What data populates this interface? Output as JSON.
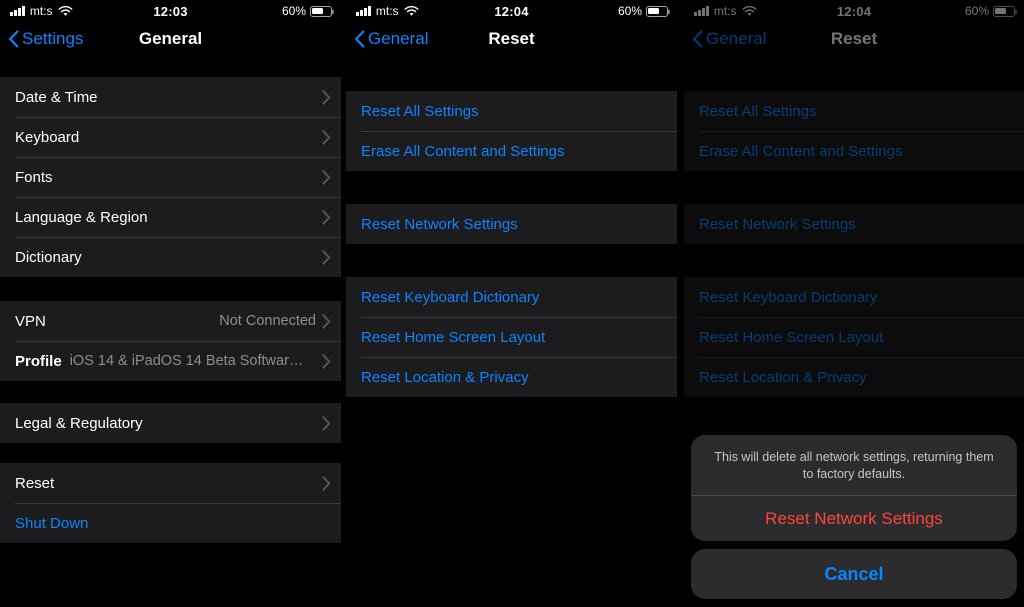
{
  "panels": [
    {
      "status": {
        "carrier": "mt:s",
        "time": "12:03",
        "battery_pct": "60%",
        "signal_icon": "cellular-bars-icon",
        "wifi_icon": "wifi-icon",
        "battery_icon": "battery-icon"
      },
      "nav": {
        "back_label": "Settings",
        "title": "General",
        "back_icon": "chevron-left-icon"
      },
      "sections": [
        {
          "rows": [
            {
              "label": "Date & Time",
              "chevron": true
            },
            {
              "label": "Keyboard",
              "chevron": true
            },
            {
              "label": "Fonts",
              "chevron": true
            },
            {
              "label": "Language & Region",
              "chevron": true
            },
            {
              "label": "Dictionary",
              "chevron": true
            }
          ]
        },
        {
          "rows": [
            {
              "label": "VPN",
              "value": "Not Connected",
              "chevron": true
            },
            {
              "label": "Profile",
              "bold": true,
              "value_inline": "iOS 14 & iPadOS 14 Beta Softwar…",
              "chevron": true
            }
          ]
        },
        {
          "rows": [
            {
              "label": "Legal & Regulatory",
              "chevron": true
            }
          ]
        },
        {
          "rows": [
            {
              "label": "Reset",
              "chevron": true
            },
            {
              "label": "Shut Down",
              "blue": true,
              "chevron": false
            }
          ]
        }
      ]
    },
    {
      "status": {
        "carrier": "mt:s",
        "time": "12:04",
        "battery_pct": "60%",
        "signal_icon": "cellular-bars-icon",
        "wifi_icon": "wifi-icon",
        "battery_icon": "battery-icon"
      },
      "nav": {
        "back_label": "General",
        "title": "Reset",
        "back_icon": "chevron-left-icon"
      },
      "sections": [
        {
          "rows": [
            {
              "label": "Reset All Settings",
              "blue": true
            },
            {
              "label": "Erase All Content and Settings",
              "blue": true
            }
          ]
        },
        {
          "rows": [
            {
              "label": "Reset Network Settings",
              "blue": true
            }
          ]
        },
        {
          "rows": [
            {
              "label": "Reset Keyboard Dictionary",
              "blue": true
            },
            {
              "label": "Reset Home Screen Layout",
              "blue": true
            },
            {
              "label": "Reset Location & Privacy",
              "blue": true
            }
          ]
        }
      ]
    },
    {
      "status": {
        "carrier": "mt:s",
        "time": "12:04",
        "battery_pct": "60%",
        "signal_icon": "cellular-bars-icon",
        "wifi_icon": "wifi-icon",
        "battery_icon": "battery-icon"
      },
      "nav": {
        "back_label": "General",
        "title": "Reset",
        "back_icon": "chevron-left-icon"
      },
      "sections": [
        {
          "rows": [
            {
              "label": "Reset All Settings",
              "blue": true
            },
            {
              "label": "Erase All Content and Settings",
              "blue": true
            }
          ]
        },
        {
          "rows": [
            {
              "label": "Reset Network Settings",
              "blue": true
            }
          ]
        },
        {
          "rows": [
            {
              "label": "Reset Keyboard Dictionary",
              "blue": true
            },
            {
              "label": "Reset Home Screen Layout",
              "blue": true
            },
            {
              "label": "Reset Location & Privacy",
              "blue": true
            }
          ]
        }
      ],
      "action_sheet": {
        "message": "This will delete all network settings, returning them to factory defaults.",
        "destructive_label": "Reset Network Settings",
        "cancel_label": "Cancel"
      }
    }
  ],
  "colors": {
    "accent_blue": "#0a84ff",
    "destructive_red": "#ff453a",
    "row_bg": "#1c1c1e",
    "sheet_bg": "#2c2c2e",
    "separator": "#38383a",
    "secondary_text": "#8e8e93",
    "background": "#000000"
  }
}
